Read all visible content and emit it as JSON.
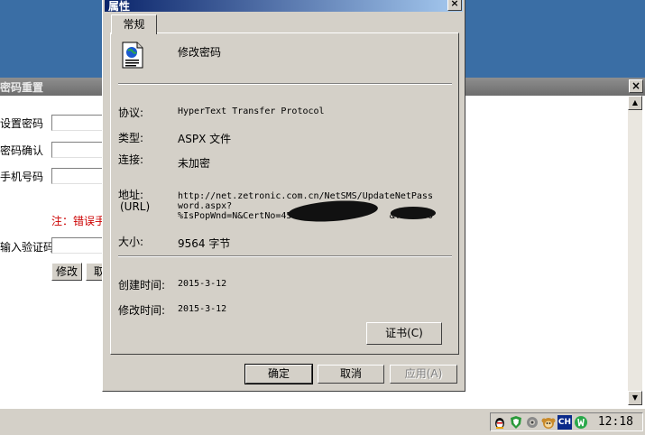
{
  "background_page": {
    "title": "密码重置",
    "close_glyph": "×",
    "form": {
      "fields": [
        {
          "label": "设置密码"
        },
        {
          "label": "密码确认"
        },
        {
          "label": "手机号码"
        }
      ],
      "error_note": "注：错误手",
      "captcha_label": "输入验证码",
      "submit_label": "修改",
      "reset_label": "取"
    }
  },
  "dialog": {
    "title": "属性",
    "close_glyph": "×",
    "tab_label": "常规",
    "file_name": "修改密码",
    "properties": {
      "protocol": {
        "label": "协议:",
        "value": "HyperText Transfer Protocol"
      },
      "type": {
        "label": "类型:",
        "value": "ASPX 文件"
      },
      "connection": {
        "label": "连接:",
        "value": "未加密"
      },
      "address": {
        "label": "地址:",
        "label_sub": "(URL)",
        "value": "http://net.zetronic.com.cn/NetSMS/UpdateNetPass\nword.aspx?\n%IsPopWnd=N&CertNo=450                 &Tel=150"
      },
      "size": {
        "label": "大小:",
        "value": "9564 字节"
      },
      "created": {
        "label": "创建时间:",
        "value": "2015-3-12"
      },
      "modified": {
        "label": "修改时间:",
        "value": "2015-3-12"
      }
    },
    "cert_button": "证书(C)",
    "ok_button": "确定",
    "cancel_button": "取消",
    "apply_button": "应用(A)"
  },
  "taskbar": {
    "tray_icons": [
      "qq-icon",
      "shield-icon",
      "network-icon",
      "monkey-icon",
      "ch-input-icon",
      "security-icon"
    ],
    "ime_label": "CH",
    "clock": "12:18"
  }
}
